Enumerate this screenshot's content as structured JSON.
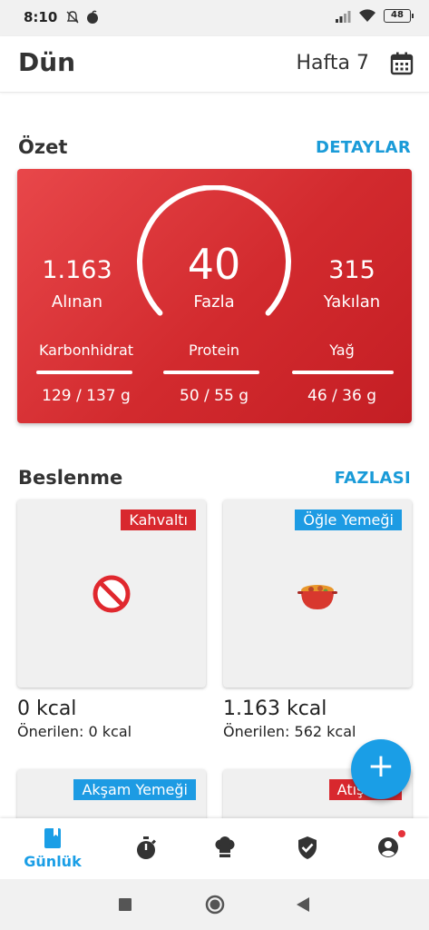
{
  "status_bar": {
    "time": "8:10",
    "battery": "48"
  },
  "header": {
    "title": "Dün",
    "week": "Hafta 7",
    "calendar_icon": "calendar-icon"
  },
  "summary": {
    "section_title": "Özet",
    "details_link": "DETAYLAR",
    "intake_value": "1.163",
    "intake_label": "Alınan",
    "center_value": "40",
    "center_label": "Fazla",
    "burned_value": "315",
    "burned_label": "Yakılan",
    "macros": [
      {
        "name": "Karbonhidrat",
        "value": "129 / 137 g"
      },
      {
        "name": "Protein",
        "value": "50 / 55 g"
      },
      {
        "name": "Yağ",
        "value": "46 / 36 g"
      }
    ],
    "colors": {
      "card": "#d22a2e",
      "gauge": "#ffffff"
    }
  },
  "nutrition": {
    "section_title": "Beslenme",
    "more_link": "FAZLASI",
    "meals": [
      {
        "tag": "Kahvaltı",
        "icon": "prohibited-icon",
        "kcal": "0 kcal",
        "recommended": "Önerilen: 0 kcal"
      },
      {
        "tag": "Öğle Yemeği",
        "icon": "pot-of-food-icon",
        "kcal": "1.163 kcal",
        "recommended": "Önerilen: 562 kcal"
      },
      {
        "tag": "Akşam Yemeği"
      },
      {
        "tag": "Atıştırm"
      }
    ]
  },
  "fab": {
    "label": "+"
  },
  "bottom_nav": {
    "items": [
      {
        "label": "Günlük",
        "icon": "diary-icon",
        "active": true
      },
      {
        "icon": "timer-icon"
      },
      {
        "icon": "chef-hat-icon"
      },
      {
        "icon": "shield-check-icon"
      },
      {
        "icon": "account-icon"
      }
    ]
  },
  "accent_color": "#1a9ee6"
}
